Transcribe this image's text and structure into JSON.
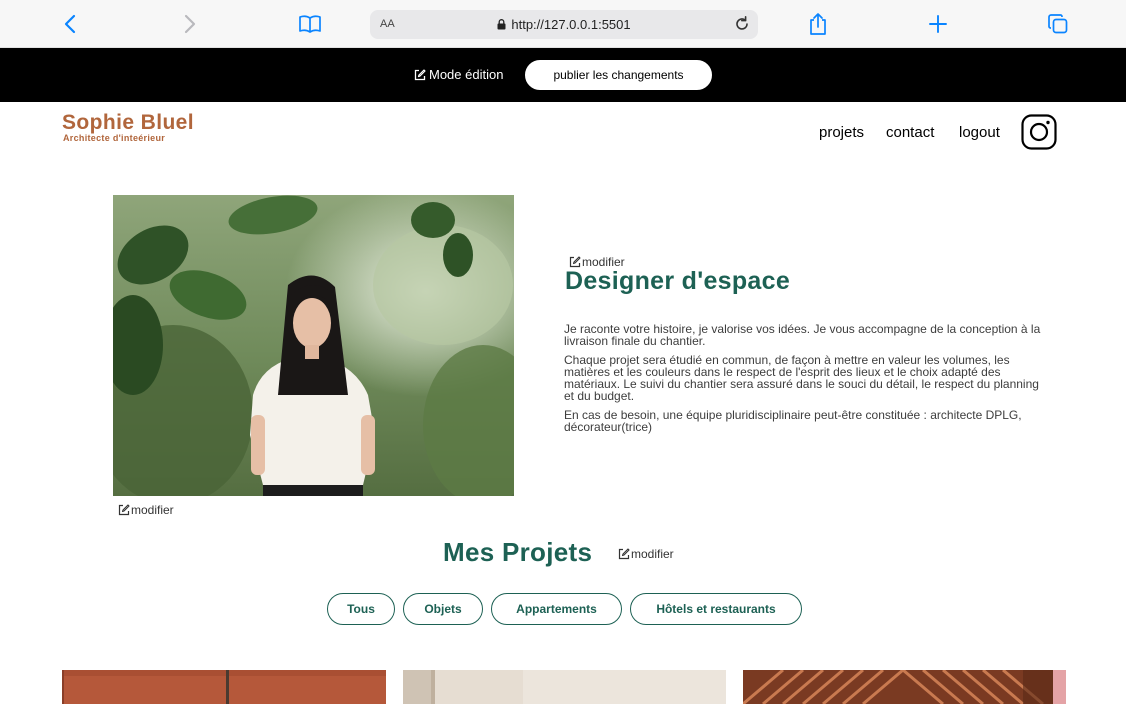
{
  "browser": {
    "text_size_label": "AA",
    "url": "http://127.0.0.1:5501"
  },
  "edit_bar": {
    "mode_label": "Mode édition",
    "publish_label": "publier les changements"
  },
  "header": {
    "logo_title": "Sophie Bluel",
    "logo_subtitle": "Architecte d'inteérieur",
    "nav": [
      "projets",
      "contact",
      "logout"
    ]
  },
  "introduction": {
    "photo_modify_label": "modifier",
    "text_modify_label": "modifier",
    "title": "Designer d'espace",
    "paragraphs": [
      "Je raconte votre histoire, je valorise vos idées. Je vous accompagne de la conception à la livraison finale du chantier.",
      "Chaque projet sera étudié en commun, de façon à mettre en valeur les volumes, les matières et les couleurs dans le respect de l'esprit des lieux et le choix adapté des matériaux. Le suivi du chantier sera assuré dans le souci du détail, le respect du planning et du budget.",
      "En cas de besoin, une équipe pluridisciplinaire peut-être constituée : architecte DPLG, décorateur(trice)"
    ]
  },
  "portfolio": {
    "title": "Mes Projets",
    "modify_label": "modifier",
    "filters": [
      "Tous",
      "Objets",
      "Appartements",
      "Hôtels et restaurants"
    ]
  },
  "colors": {
    "brand_orange": "#b1663c",
    "brand_green": "#1d6154",
    "edit_bar_bg": "#000000",
    "ios_blue": "#0a84ff"
  }
}
